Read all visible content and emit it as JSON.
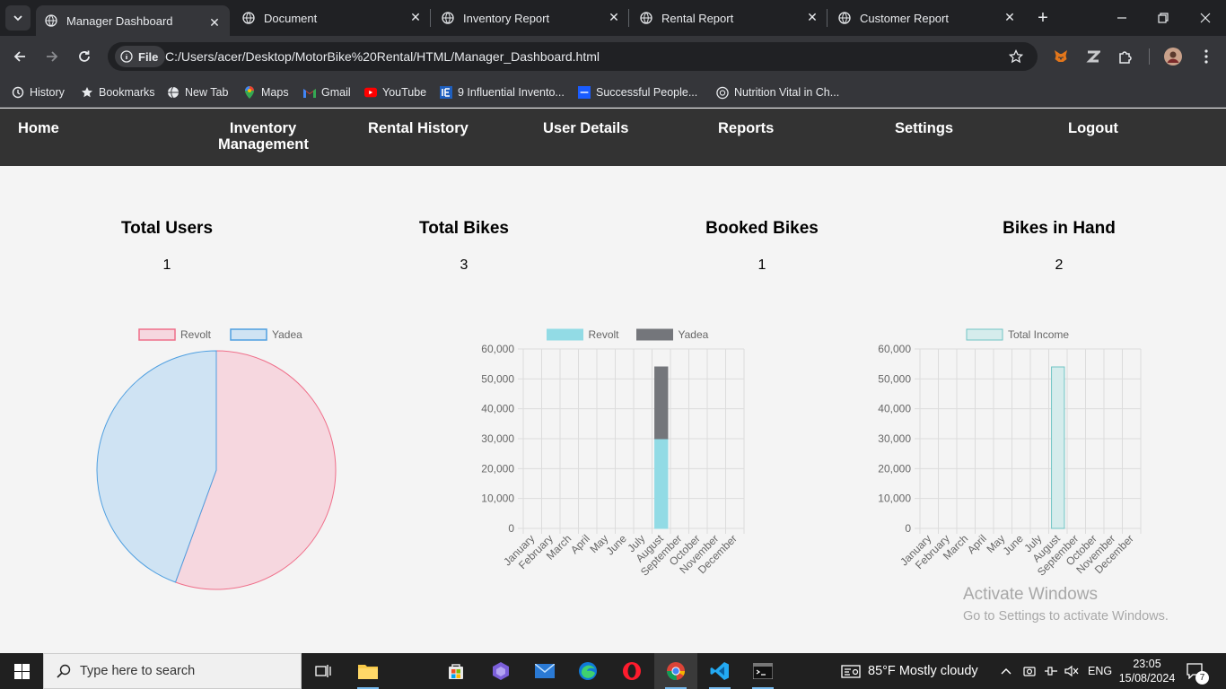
{
  "browser": {
    "tabs": [
      {
        "title": "Manager Dashboard",
        "active": true
      },
      {
        "title": "Document",
        "active": false
      },
      {
        "title": "Inventory Report",
        "active": false
      },
      {
        "title": "Rental Report",
        "active": false
      },
      {
        "title": "Customer Report",
        "active": false
      }
    ],
    "omnibox": {
      "chip_label": "File",
      "url": "C:/Users/acer/Desktop/MotorBike%20Rental/HTML/Manager_Dashboard.html"
    },
    "bookmarks": [
      {
        "label": "History",
        "icon": "history-icon"
      },
      {
        "label": "Bookmarks",
        "icon": "star-icon"
      },
      {
        "label": "New Tab",
        "icon": "globe-icon"
      },
      {
        "label": "Maps",
        "icon": "maps-icon"
      },
      {
        "label": "Gmail",
        "icon": "gmail-icon"
      },
      {
        "label": "YouTube",
        "icon": "youtube-icon"
      },
      {
        "label": "9 Influential Invento...",
        "icon": "ie-icon"
      },
      {
        "label": "Successful People...",
        "icon": "site-icon"
      },
      {
        "label": "Nutrition Vital in Ch...",
        "icon": "openai-icon"
      }
    ]
  },
  "nav": {
    "home": "Home",
    "inventory_line1": "Inventory",
    "inventory_line2": "Management",
    "rental_history": "Rental History",
    "user_details": "User Details",
    "reports": "Reports",
    "settings": "Settings",
    "logout": "Logout"
  },
  "stats": [
    {
      "title": "Total Users",
      "value": "1"
    },
    {
      "title": "Total Bikes",
      "value": "3"
    },
    {
      "title": "Booked Bikes",
      "value": "1"
    },
    {
      "title": "Bikes in Hand",
      "value": "2"
    }
  ],
  "colors": {
    "revolt_fill": "#f6d7df",
    "revolt_stroke": "#ef6f8a",
    "yadea_fill": "#cfe3f3",
    "yadea_stroke": "#4f9fe0",
    "bar_revolt": "#92dbe5",
    "bar_yadea": "#74767b",
    "income_fill": "#d5ecec",
    "income_stroke": "#6fc5c5"
  },
  "chart_data": [
    {
      "type": "pie",
      "legend": [
        "Revolt",
        "Yadea"
      ],
      "values": [
        30000,
        24000
      ]
    },
    {
      "type": "bar",
      "stacked": true,
      "categories": [
        "January",
        "February",
        "March",
        "April",
        "May",
        "June",
        "July",
        "August",
        "September",
        "October",
        "November",
        "December"
      ],
      "series": [
        {
          "name": "Revolt",
          "values": [
            0,
            0,
            0,
            0,
            0,
            0,
            0,
            30000,
            0,
            0,
            0,
            0
          ]
        },
        {
          "name": "Yadea",
          "values": [
            0,
            0,
            0,
            0,
            0,
            0,
            0,
            24000,
            0,
            0,
            0,
            0
          ]
        }
      ],
      "yticks": [
        "0",
        "10,000",
        "20,000",
        "30,000",
        "40,000",
        "50,000",
        "60,000"
      ],
      "ylim": [
        0,
        60000
      ],
      "grid": true,
      "legend_position": "top"
    },
    {
      "type": "bar",
      "categories": [
        "January",
        "February",
        "March",
        "April",
        "May",
        "June",
        "July",
        "August",
        "September",
        "October",
        "November",
        "December"
      ],
      "series": [
        {
          "name": "Total Income",
          "values": [
            0,
            0,
            0,
            0,
            0,
            0,
            0,
            54000,
            0,
            0,
            0,
            0
          ]
        }
      ],
      "yticks": [
        "0",
        "10,000",
        "20,000",
        "30,000",
        "40,000",
        "50,000",
        "60,000"
      ],
      "ylim": [
        0,
        60000
      ],
      "grid": true,
      "legend_position": "top"
    }
  ],
  "watermark": {
    "line1": "Activate Windows",
    "line2": "Go to Settings to activate Windows."
  },
  "taskbar": {
    "search_placeholder": "Type here to search",
    "weather": "85°F  Mostly cloudy",
    "language": "ENG",
    "time": "23:05",
    "date": "15/08/2024",
    "notification_count": "7"
  }
}
